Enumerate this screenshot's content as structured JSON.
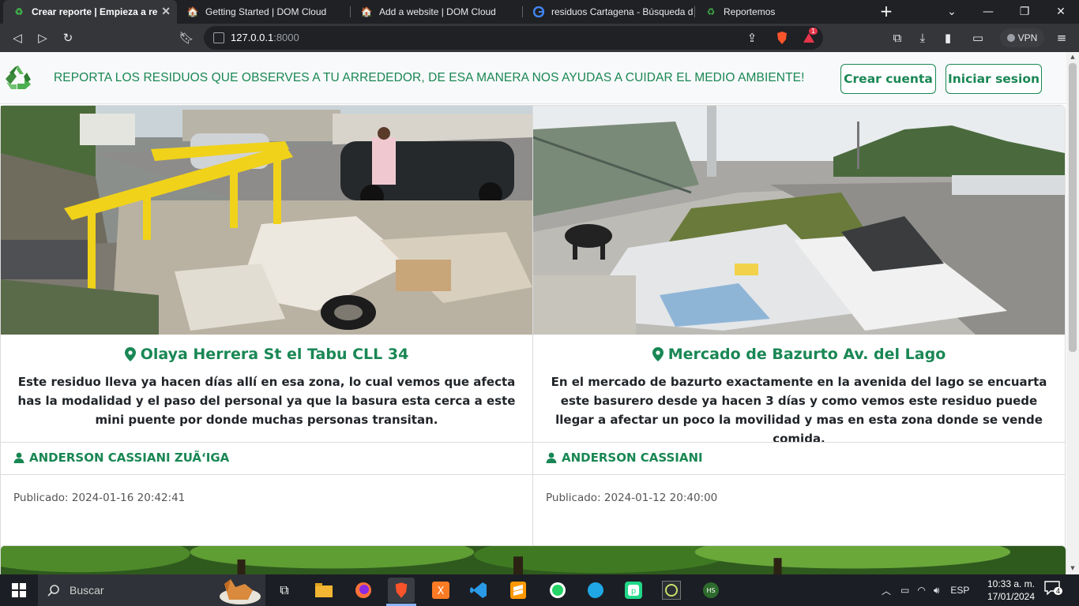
{
  "browser": {
    "tabs": [
      {
        "title": "Crear reporte | Empieza a rep",
        "active": true
      },
      {
        "title": "Getting Started | DOM Cloud",
        "active": false
      },
      {
        "title": "Add a website | DOM Cloud",
        "active": false
      },
      {
        "title": "residuos Cartagena - Búsqueda de",
        "active": false
      },
      {
        "title": "Reportemos",
        "active": false
      }
    ],
    "url_host": "127.0.0.1",
    "url_port": ":8000",
    "shield_badge": "1",
    "vpn_label": "VPN"
  },
  "site": {
    "banner": "REPORTA LOS RESIDUOS QUE OBSERVES A TU ARREDEDOR, DE ESA MANERA NOS AYUDAS A CUIDAR EL MEDIO AMBIENTE!",
    "create_account": "Crear cuenta",
    "login": "Iniciar sesion",
    "accent": "#198754"
  },
  "reports": [
    {
      "location": "Olaya Herrera St el Tabu CLL 34",
      "description": "Este residuo lleva ya hacen días allí en esa zona, lo cual vemos que afecta has la modalidad y el paso del personal ya que la basura esta cerca a este mini puente por donde muchas personas transitan.",
      "author": "ANDERSON CASSIANI ZUÃ‘IGA",
      "published": "Publicado: 2024-01-16 20:42:41"
    },
    {
      "location": "Mercado de Bazurto Av. del Lago",
      "description": "En el mercado de bazurto exactamente en la avenida del lago se encuarta este basurero desde ya hacen 3 días y como vemos este residuo puede llegar a afectar un poco la movilidad y mas en esta zona donde se vende comida.",
      "author": "ANDERSON CASSIANI",
      "published": "Publicado: 2024-01-12 20:40:00"
    }
  ],
  "taskbar": {
    "search_label": "Buscar",
    "language": "ESP",
    "time": "10:33 a. m.",
    "date": "17/01/2024",
    "notifications": "4"
  }
}
